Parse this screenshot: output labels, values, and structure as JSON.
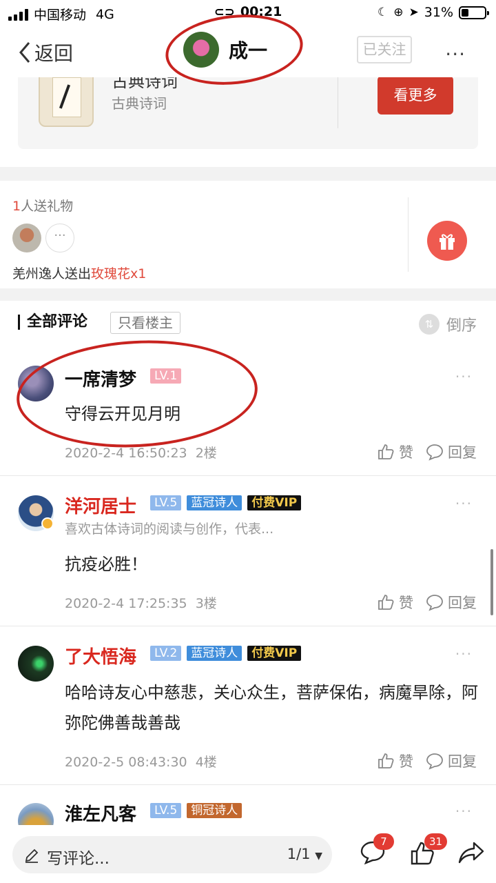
{
  "status_bar": {
    "carrier": "中国移动",
    "network": "4G",
    "time": "00:21",
    "battery": "31%"
  },
  "nav": {
    "back_label": "返回",
    "user_name": "成一",
    "follow_label": "已关注",
    "more_label": "···"
  },
  "book_card": {
    "title": "古典诗词",
    "subtitle": "古典诗词",
    "see_more": "看更多"
  },
  "gifts": {
    "count": "1",
    "count_suffix": "人送礼物",
    "more": "···",
    "giver": "羌州逸人",
    "verb": "送出",
    "gift": "玫瑰花x1"
  },
  "comments_header": {
    "title": "全部评论",
    "filter_label": "只看楼主",
    "sort_label": "倒序"
  },
  "comments": [
    {
      "name": "一席清梦",
      "level": "LV.1",
      "text": "守得云开见月明",
      "time": "2020-2-4 16:50:23",
      "floor": "2楼"
    },
    {
      "name": "洋河居士",
      "level": "LV.5",
      "title_badge": "蓝冠诗人",
      "vip": "付费VIP",
      "bio": "喜欢古体诗词的阅读与创作，代表...",
      "text": "抗疫必胜！",
      "time": "2020-2-4 17:25:35",
      "floor": "3楼"
    },
    {
      "name": "了大悟海",
      "level": "LV.2",
      "title_badge": "蓝冠诗人",
      "vip": "付费VIP",
      "text": "哈哈诗友心中慈悲，关心众生，菩萨保佑，病魔旱除，阿弥陀佛善哉善哉",
      "time": "2020-2-5 08:43:30",
      "floor": "4楼"
    },
    {
      "name": "淮左凡客",
      "level": "LV.5",
      "title_badge": "铜冠诗人"
    }
  ],
  "actions": {
    "like": "赞",
    "reply": "回复",
    "more": "···"
  },
  "bottom_bar": {
    "compose_placeholder": "写评论...",
    "page": "1/1",
    "comment_count": "7",
    "like_count": "31"
  },
  "colors": {
    "accent_red": "#d13a2c",
    "annotation_red": "#c8231f",
    "level_blue": "#8fb8ec",
    "crown_blue": "#3f8ddb"
  }
}
